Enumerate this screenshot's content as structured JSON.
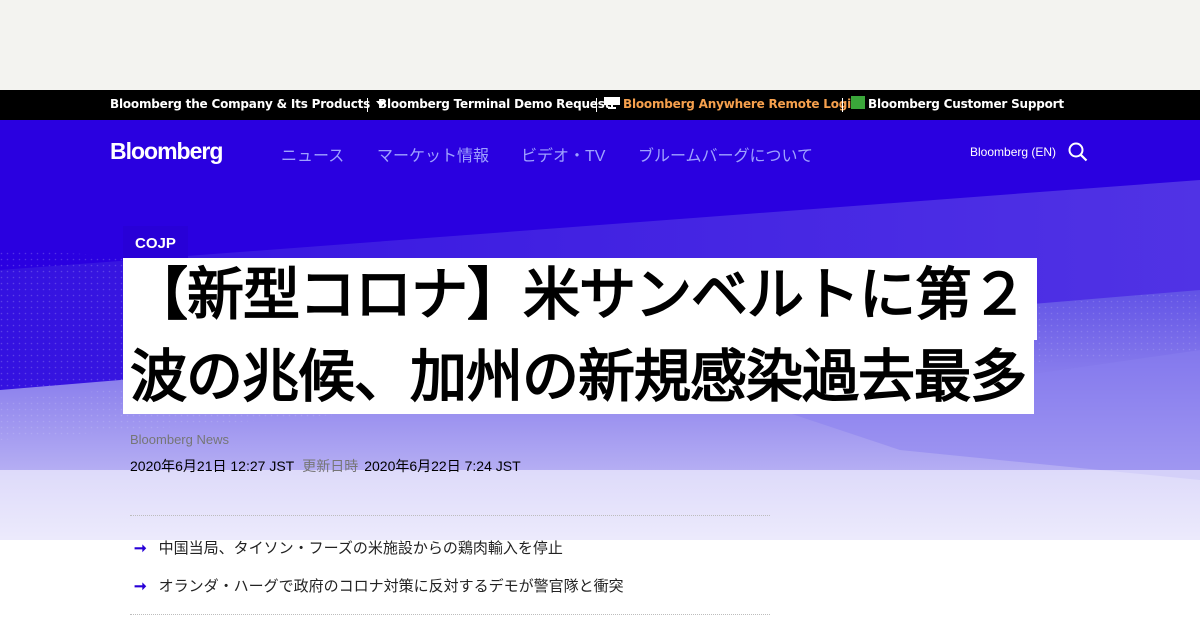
{
  "topbar": {
    "company": "Bloomberg the Company & Its Products",
    "demo": "Bloomberg Terminal Demo Request",
    "anywhere": "Bloomberg Anywhere Remote Login",
    "support": "Bloomberg Customer Support",
    "colors": {
      "anywhere": "#f6a04d",
      "background": "#000000"
    }
  },
  "nav": {
    "logo": "Bloomberg",
    "links": [
      "ニュース",
      "マーケット情報",
      "ビデオ・TV",
      "ブルームバーグについて"
    ],
    "lang": "Bloomberg (EN)",
    "search_icon": "search-icon"
  },
  "article": {
    "section": "COJP",
    "title_lines": [
      "【新型コロナ】米サンベルトに第２",
      "波の兆候、加州の新規感染過去最多"
    ],
    "author": "Bloomberg News",
    "published": "2020年6月21日 12:27 JST",
    "updated_label": "更新日時",
    "updated": "2020年6月22日 7:24 JST",
    "bullets": [
      "中国当局、タイソン・フーズの米施設からの鶏肉輸入を停止",
      "オランダ・ハーグで政府のコロナ対策に反対するデモが警官隊と衝突"
    ]
  },
  "colors": {
    "brand_blue": "#2800d7",
    "nav_link": "#9fa2ff"
  }
}
